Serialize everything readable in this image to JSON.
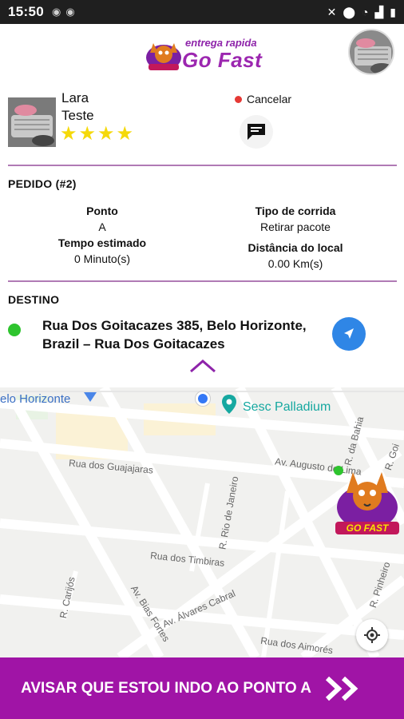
{
  "status_bar": {
    "time": "15:50"
  },
  "header": {
    "logo_tagline": "entrega rapida",
    "logo_brand": "Go Fast"
  },
  "driver": {
    "first_name": "Lara",
    "last_name": "Teste",
    "rating": 4,
    "rating_max": 4
  },
  "actions": {
    "cancel_label": "Cancelar"
  },
  "order": {
    "title": "PEDIDO (#2)",
    "ponto_label": "Ponto",
    "ponto_value": "A",
    "tempo_label": "Tempo estimado",
    "tempo_value": "0 Minuto(s)",
    "tipo_label": "Tipo de corrida",
    "tipo_value": "Retirar pacote",
    "distancia_label": "Distância do local",
    "distancia_value": "0.00 Km(s)"
  },
  "destination": {
    "title": "DESTINO",
    "address": "Rua Dos Goitacazes 385, Belo Horizonte, Brazil – Rua Dos Goitacazes"
  },
  "map": {
    "labels": {
      "belo_horizonte": "elo Horizonte",
      "sesc": "Sesc Palladium",
      "guajajaras": "Rua dos Guajajaras",
      "augusto": "Av. Augusto de Lima",
      "rio_janeiro": "R. Rio de Janeiro",
      "bahia": "R. da Bahia",
      "timbiras": "Rua dos Timbiras",
      "carijos": "R. Carijós",
      "bias_fortes": "Av. Bias Fortes",
      "alvares_cabral": "Av. Álvares Cabral",
      "aimores": "Rua dos Aimorés",
      "pinheiro": "R. Pinheiro",
      "goias": "R. Goi",
      "marker_brand": "GO FAST"
    }
  },
  "cta": {
    "label": "AVISAR QUE ESTOU INDO AO PONTO A"
  },
  "colors": {
    "brand": "#a014a6",
    "divider": "#b07ab5",
    "star": "#f5d90a",
    "nav": "#2f86e6",
    "dest_dot": "#2ec42e"
  }
}
